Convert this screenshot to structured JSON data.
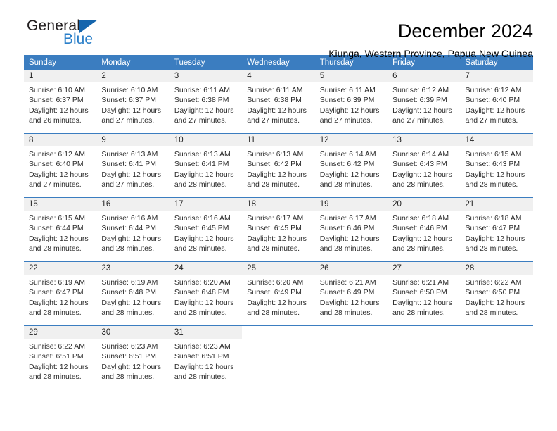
{
  "brand": {
    "name_top": "General",
    "name_bottom": "Blue",
    "accent_color": "#2a7fc9",
    "triangle_color": "#1565ad"
  },
  "header": {
    "title": "December 2024",
    "subtitle": "Kiunga, Western Province, Papua New Guinea"
  },
  "calendar": {
    "header_bg": "#3b7dc0",
    "daycell_header_bg": "#f0f0f0",
    "weekdays": [
      "Sunday",
      "Monday",
      "Tuesday",
      "Wednesday",
      "Thursday",
      "Friday",
      "Saturday"
    ],
    "weeks": [
      [
        {
          "date": "1",
          "sunrise": "Sunrise: 6:10 AM",
          "sunset": "Sunset: 6:37 PM",
          "daylight1": "Daylight: 12 hours",
          "daylight2": "and 26 minutes."
        },
        {
          "date": "2",
          "sunrise": "Sunrise: 6:10 AM",
          "sunset": "Sunset: 6:37 PM",
          "daylight1": "Daylight: 12 hours",
          "daylight2": "and 27 minutes."
        },
        {
          "date": "3",
          "sunrise": "Sunrise: 6:11 AM",
          "sunset": "Sunset: 6:38 PM",
          "daylight1": "Daylight: 12 hours",
          "daylight2": "and 27 minutes."
        },
        {
          "date": "4",
          "sunrise": "Sunrise: 6:11 AM",
          "sunset": "Sunset: 6:38 PM",
          "daylight1": "Daylight: 12 hours",
          "daylight2": "and 27 minutes."
        },
        {
          "date": "5",
          "sunrise": "Sunrise: 6:11 AM",
          "sunset": "Sunset: 6:39 PM",
          "daylight1": "Daylight: 12 hours",
          "daylight2": "and 27 minutes."
        },
        {
          "date": "6",
          "sunrise": "Sunrise: 6:12 AM",
          "sunset": "Sunset: 6:39 PM",
          "daylight1": "Daylight: 12 hours",
          "daylight2": "and 27 minutes."
        },
        {
          "date": "7",
          "sunrise": "Sunrise: 6:12 AM",
          "sunset": "Sunset: 6:40 PM",
          "daylight1": "Daylight: 12 hours",
          "daylight2": "and 27 minutes."
        }
      ],
      [
        {
          "date": "8",
          "sunrise": "Sunrise: 6:12 AM",
          "sunset": "Sunset: 6:40 PM",
          "daylight1": "Daylight: 12 hours",
          "daylight2": "and 27 minutes."
        },
        {
          "date": "9",
          "sunrise": "Sunrise: 6:13 AM",
          "sunset": "Sunset: 6:41 PM",
          "daylight1": "Daylight: 12 hours",
          "daylight2": "and 27 minutes."
        },
        {
          "date": "10",
          "sunrise": "Sunrise: 6:13 AM",
          "sunset": "Sunset: 6:41 PM",
          "daylight1": "Daylight: 12 hours",
          "daylight2": "and 28 minutes."
        },
        {
          "date": "11",
          "sunrise": "Sunrise: 6:13 AM",
          "sunset": "Sunset: 6:42 PM",
          "daylight1": "Daylight: 12 hours",
          "daylight2": "and 28 minutes."
        },
        {
          "date": "12",
          "sunrise": "Sunrise: 6:14 AM",
          "sunset": "Sunset: 6:42 PM",
          "daylight1": "Daylight: 12 hours",
          "daylight2": "and 28 minutes."
        },
        {
          "date": "13",
          "sunrise": "Sunrise: 6:14 AM",
          "sunset": "Sunset: 6:43 PM",
          "daylight1": "Daylight: 12 hours",
          "daylight2": "and 28 minutes."
        },
        {
          "date": "14",
          "sunrise": "Sunrise: 6:15 AM",
          "sunset": "Sunset: 6:43 PM",
          "daylight1": "Daylight: 12 hours",
          "daylight2": "and 28 minutes."
        }
      ],
      [
        {
          "date": "15",
          "sunrise": "Sunrise: 6:15 AM",
          "sunset": "Sunset: 6:44 PM",
          "daylight1": "Daylight: 12 hours",
          "daylight2": "and 28 minutes."
        },
        {
          "date": "16",
          "sunrise": "Sunrise: 6:16 AM",
          "sunset": "Sunset: 6:44 PM",
          "daylight1": "Daylight: 12 hours",
          "daylight2": "and 28 minutes."
        },
        {
          "date": "17",
          "sunrise": "Sunrise: 6:16 AM",
          "sunset": "Sunset: 6:45 PM",
          "daylight1": "Daylight: 12 hours",
          "daylight2": "and 28 minutes."
        },
        {
          "date": "18",
          "sunrise": "Sunrise: 6:17 AM",
          "sunset": "Sunset: 6:45 PM",
          "daylight1": "Daylight: 12 hours",
          "daylight2": "and 28 minutes."
        },
        {
          "date": "19",
          "sunrise": "Sunrise: 6:17 AM",
          "sunset": "Sunset: 6:46 PM",
          "daylight1": "Daylight: 12 hours",
          "daylight2": "and 28 minutes."
        },
        {
          "date": "20",
          "sunrise": "Sunrise: 6:18 AM",
          "sunset": "Sunset: 6:46 PM",
          "daylight1": "Daylight: 12 hours",
          "daylight2": "and 28 minutes."
        },
        {
          "date": "21",
          "sunrise": "Sunrise: 6:18 AM",
          "sunset": "Sunset: 6:47 PM",
          "daylight1": "Daylight: 12 hours",
          "daylight2": "and 28 minutes."
        }
      ],
      [
        {
          "date": "22",
          "sunrise": "Sunrise: 6:19 AM",
          "sunset": "Sunset: 6:47 PM",
          "daylight1": "Daylight: 12 hours",
          "daylight2": "and 28 minutes."
        },
        {
          "date": "23",
          "sunrise": "Sunrise: 6:19 AM",
          "sunset": "Sunset: 6:48 PM",
          "daylight1": "Daylight: 12 hours",
          "daylight2": "and 28 minutes."
        },
        {
          "date": "24",
          "sunrise": "Sunrise: 6:20 AM",
          "sunset": "Sunset: 6:48 PM",
          "daylight1": "Daylight: 12 hours",
          "daylight2": "and 28 minutes."
        },
        {
          "date": "25",
          "sunrise": "Sunrise: 6:20 AM",
          "sunset": "Sunset: 6:49 PM",
          "daylight1": "Daylight: 12 hours",
          "daylight2": "and 28 minutes."
        },
        {
          "date": "26",
          "sunrise": "Sunrise: 6:21 AM",
          "sunset": "Sunset: 6:49 PM",
          "daylight1": "Daylight: 12 hours",
          "daylight2": "and 28 minutes."
        },
        {
          "date": "27",
          "sunrise": "Sunrise: 6:21 AM",
          "sunset": "Sunset: 6:50 PM",
          "daylight1": "Daylight: 12 hours",
          "daylight2": "and 28 minutes."
        },
        {
          "date": "28",
          "sunrise": "Sunrise: 6:22 AM",
          "sunset": "Sunset: 6:50 PM",
          "daylight1": "Daylight: 12 hours",
          "daylight2": "and 28 minutes."
        }
      ],
      [
        {
          "date": "29",
          "sunrise": "Sunrise: 6:22 AM",
          "sunset": "Sunset: 6:51 PM",
          "daylight1": "Daylight: 12 hours",
          "daylight2": "and 28 minutes."
        },
        {
          "date": "30",
          "sunrise": "Sunrise: 6:23 AM",
          "sunset": "Sunset: 6:51 PM",
          "daylight1": "Daylight: 12 hours",
          "daylight2": "and 28 minutes."
        },
        {
          "date": "31",
          "sunrise": "Sunrise: 6:23 AM",
          "sunset": "Sunset: 6:51 PM",
          "daylight1": "Daylight: 12 hours",
          "daylight2": "and 28 minutes."
        },
        {
          "date": "",
          "sunrise": "",
          "sunset": "",
          "daylight1": "",
          "daylight2": ""
        },
        {
          "date": "",
          "sunrise": "",
          "sunset": "",
          "daylight1": "",
          "daylight2": ""
        },
        {
          "date": "",
          "sunrise": "",
          "sunset": "",
          "daylight1": "",
          "daylight2": ""
        },
        {
          "date": "",
          "sunrise": "",
          "sunset": "",
          "daylight1": "",
          "daylight2": ""
        }
      ]
    ]
  }
}
